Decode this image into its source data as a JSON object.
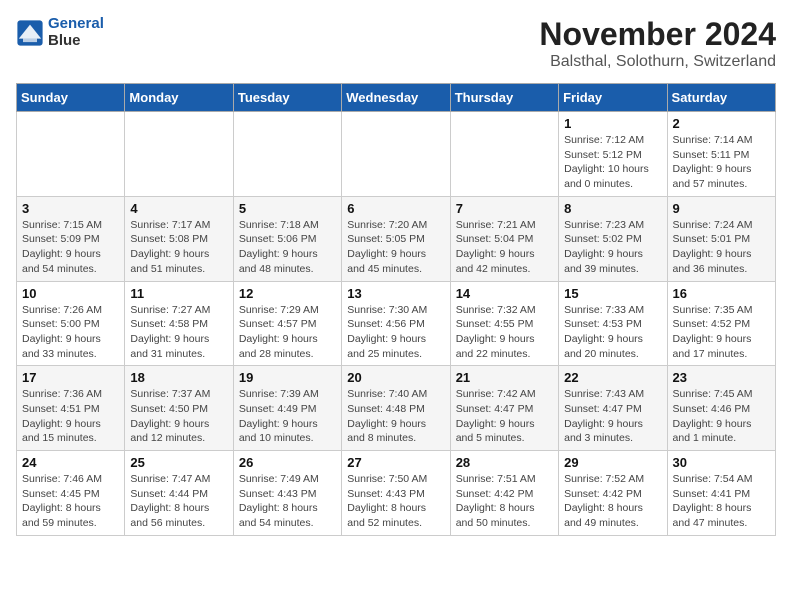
{
  "logo": {
    "line1": "General",
    "line2": "Blue"
  },
  "title": "November 2024",
  "subtitle": "Balsthal, Solothurn, Switzerland",
  "weekdays": [
    "Sunday",
    "Monday",
    "Tuesday",
    "Wednesday",
    "Thursday",
    "Friday",
    "Saturday"
  ],
  "weeks": [
    [
      {
        "day": "",
        "detail": ""
      },
      {
        "day": "",
        "detail": ""
      },
      {
        "day": "",
        "detail": ""
      },
      {
        "day": "",
        "detail": ""
      },
      {
        "day": "",
        "detail": ""
      },
      {
        "day": "1",
        "detail": "Sunrise: 7:12 AM\nSunset: 5:12 PM\nDaylight: 10 hours and 0 minutes."
      },
      {
        "day": "2",
        "detail": "Sunrise: 7:14 AM\nSunset: 5:11 PM\nDaylight: 9 hours and 57 minutes."
      }
    ],
    [
      {
        "day": "3",
        "detail": "Sunrise: 7:15 AM\nSunset: 5:09 PM\nDaylight: 9 hours and 54 minutes."
      },
      {
        "day": "4",
        "detail": "Sunrise: 7:17 AM\nSunset: 5:08 PM\nDaylight: 9 hours and 51 minutes."
      },
      {
        "day": "5",
        "detail": "Sunrise: 7:18 AM\nSunset: 5:06 PM\nDaylight: 9 hours and 48 minutes."
      },
      {
        "day": "6",
        "detail": "Sunrise: 7:20 AM\nSunset: 5:05 PM\nDaylight: 9 hours and 45 minutes."
      },
      {
        "day": "7",
        "detail": "Sunrise: 7:21 AM\nSunset: 5:04 PM\nDaylight: 9 hours and 42 minutes."
      },
      {
        "day": "8",
        "detail": "Sunrise: 7:23 AM\nSunset: 5:02 PM\nDaylight: 9 hours and 39 minutes."
      },
      {
        "day": "9",
        "detail": "Sunrise: 7:24 AM\nSunset: 5:01 PM\nDaylight: 9 hours and 36 minutes."
      }
    ],
    [
      {
        "day": "10",
        "detail": "Sunrise: 7:26 AM\nSunset: 5:00 PM\nDaylight: 9 hours and 33 minutes."
      },
      {
        "day": "11",
        "detail": "Sunrise: 7:27 AM\nSunset: 4:58 PM\nDaylight: 9 hours and 31 minutes."
      },
      {
        "day": "12",
        "detail": "Sunrise: 7:29 AM\nSunset: 4:57 PM\nDaylight: 9 hours and 28 minutes."
      },
      {
        "day": "13",
        "detail": "Sunrise: 7:30 AM\nSunset: 4:56 PM\nDaylight: 9 hours and 25 minutes."
      },
      {
        "day": "14",
        "detail": "Sunrise: 7:32 AM\nSunset: 4:55 PM\nDaylight: 9 hours and 22 minutes."
      },
      {
        "day": "15",
        "detail": "Sunrise: 7:33 AM\nSunset: 4:53 PM\nDaylight: 9 hours and 20 minutes."
      },
      {
        "day": "16",
        "detail": "Sunrise: 7:35 AM\nSunset: 4:52 PM\nDaylight: 9 hours and 17 minutes."
      }
    ],
    [
      {
        "day": "17",
        "detail": "Sunrise: 7:36 AM\nSunset: 4:51 PM\nDaylight: 9 hours and 15 minutes."
      },
      {
        "day": "18",
        "detail": "Sunrise: 7:37 AM\nSunset: 4:50 PM\nDaylight: 9 hours and 12 minutes."
      },
      {
        "day": "19",
        "detail": "Sunrise: 7:39 AM\nSunset: 4:49 PM\nDaylight: 9 hours and 10 minutes."
      },
      {
        "day": "20",
        "detail": "Sunrise: 7:40 AM\nSunset: 4:48 PM\nDaylight: 9 hours and 8 minutes."
      },
      {
        "day": "21",
        "detail": "Sunrise: 7:42 AM\nSunset: 4:47 PM\nDaylight: 9 hours and 5 minutes."
      },
      {
        "day": "22",
        "detail": "Sunrise: 7:43 AM\nSunset: 4:47 PM\nDaylight: 9 hours and 3 minutes."
      },
      {
        "day": "23",
        "detail": "Sunrise: 7:45 AM\nSunset: 4:46 PM\nDaylight: 9 hours and 1 minute."
      }
    ],
    [
      {
        "day": "24",
        "detail": "Sunrise: 7:46 AM\nSunset: 4:45 PM\nDaylight: 8 hours and 59 minutes."
      },
      {
        "day": "25",
        "detail": "Sunrise: 7:47 AM\nSunset: 4:44 PM\nDaylight: 8 hours and 56 minutes."
      },
      {
        "day": "26",
        "detail": "Sunrise: 7:49 AM\nSunset: 4:43 PM\nDaylight: 8 hours and 54 minutes."
      },
      {
        "day": "27",
        "detail": "Sunrise: 7:50 AM\nSunset: 4:43 PM\nDaylight: 8 hours and 52 minutes."
      },
      {
        "day": "28",
        "detail": "Sunrise: 7:51 AM\nSunset: 4:42 PM\nDaylight: 8 hours and 50 minutes."
      },
      {
        "day": "29",
        "detail": "Sunrise: 7:52 AM\nSunset: 4:42 PM\nDaylight: 8 hours and 49 minutes."
      },
      {
        "day": "30",
        "detail": "Sunrise: 7:54 AM\nSunset: 4:41 PM\nDaylight: 8 hours and 47 minutes."
      }
    ]
  ]
}
